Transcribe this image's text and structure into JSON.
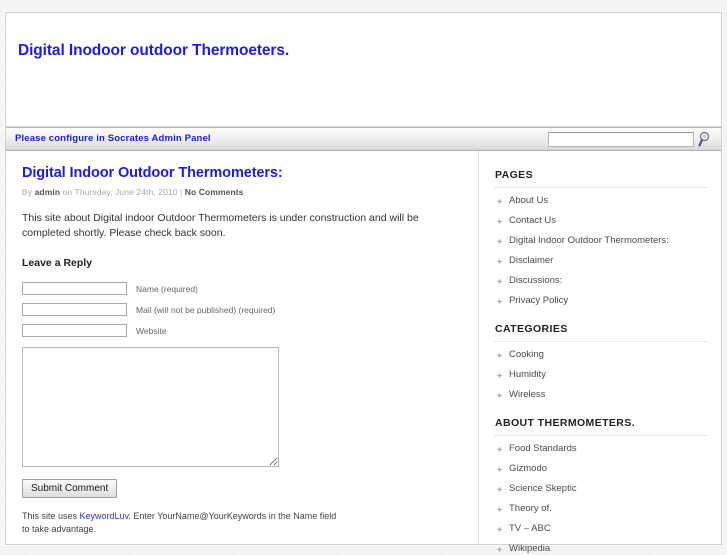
{
  "header": {
    "site_title": "Digital Inodoor outdoor Thermoeters."
  },
  "nav": {
    "message": "Please configure in Socrates Admin Panel",
    "search": {
      "value": "",
      "placeholder": "",
      "icon": "search-icon"
    }
  },
  "post": {
    "title": "Digital Indoor Outdoor Thermometers:",
    "meta_by": "By",
    "meta_author": "admin",
    "meta_on": "on Thursday, June 24th, 2010 |",
    "meta_comments": "No Comments",
    "body": "This site about Digital indoor Outdoor Thermometers is under construction and will be completed shortly. Please check back soon."
  },
  "comment_form": {
    "heading": "Leave a Reply",
    "fields": [
      {
        "name": "author",
        "value": "",
        "placeholder": "",
        "label": "Name (required)"
      },
      {
        "name": "email",
        "value": "",
        "placeholder": "",
        "label": "Mail (will not be published)  (required)"
      },
      {
        "name": "url",
        "value": "",
        "placeholder": "",
        "label": "Website"
      }
    ],
    "comment_value": "",
    "comment_placeholder": "",
    "submit_label": "Submit Comment",
    "keywordluv_pre": "This site uses ",
    "keywordluv_link": "KeywordLuv",
    "keywordluv_post": ". Enter YourName@YourKeywords in the Name field to take advantage."
  },
  "sidebar": {
    "blocks": [
      {
        "heading": "PAGES",
        "items": [
          "About Us",
          "Contact Us",
          "Digital Indoor Outdoor Thermometers:",
          "Disclaimer",
          "Discussions:",
          "Privacy Policy"
        ]
      },
      {
        "heading": "CATEGORIES",
        "items": [
          "Cooking",
          "Humidity",
          "Wireless"
        ]
      },
      {
        "heading": "ABOUT THERMOMETERS.",
        "items": [
          "Food Standards",
          "Gizmodo",
          "Science Skeptic",
          "Theory of.",
          "TV – ABC",
          "Wikipedia"
        ]
      }
    ]
  },
  "colors": {
    "heading_blue": "#1d1de0",
    "link_blue": "#3333dd",
    "text_dark": "#333333",
    "muted": "#a8a8a8",
    "page_bg": "#ffffff",
    "outer_bg": "#f4f4f4"
  }
}
